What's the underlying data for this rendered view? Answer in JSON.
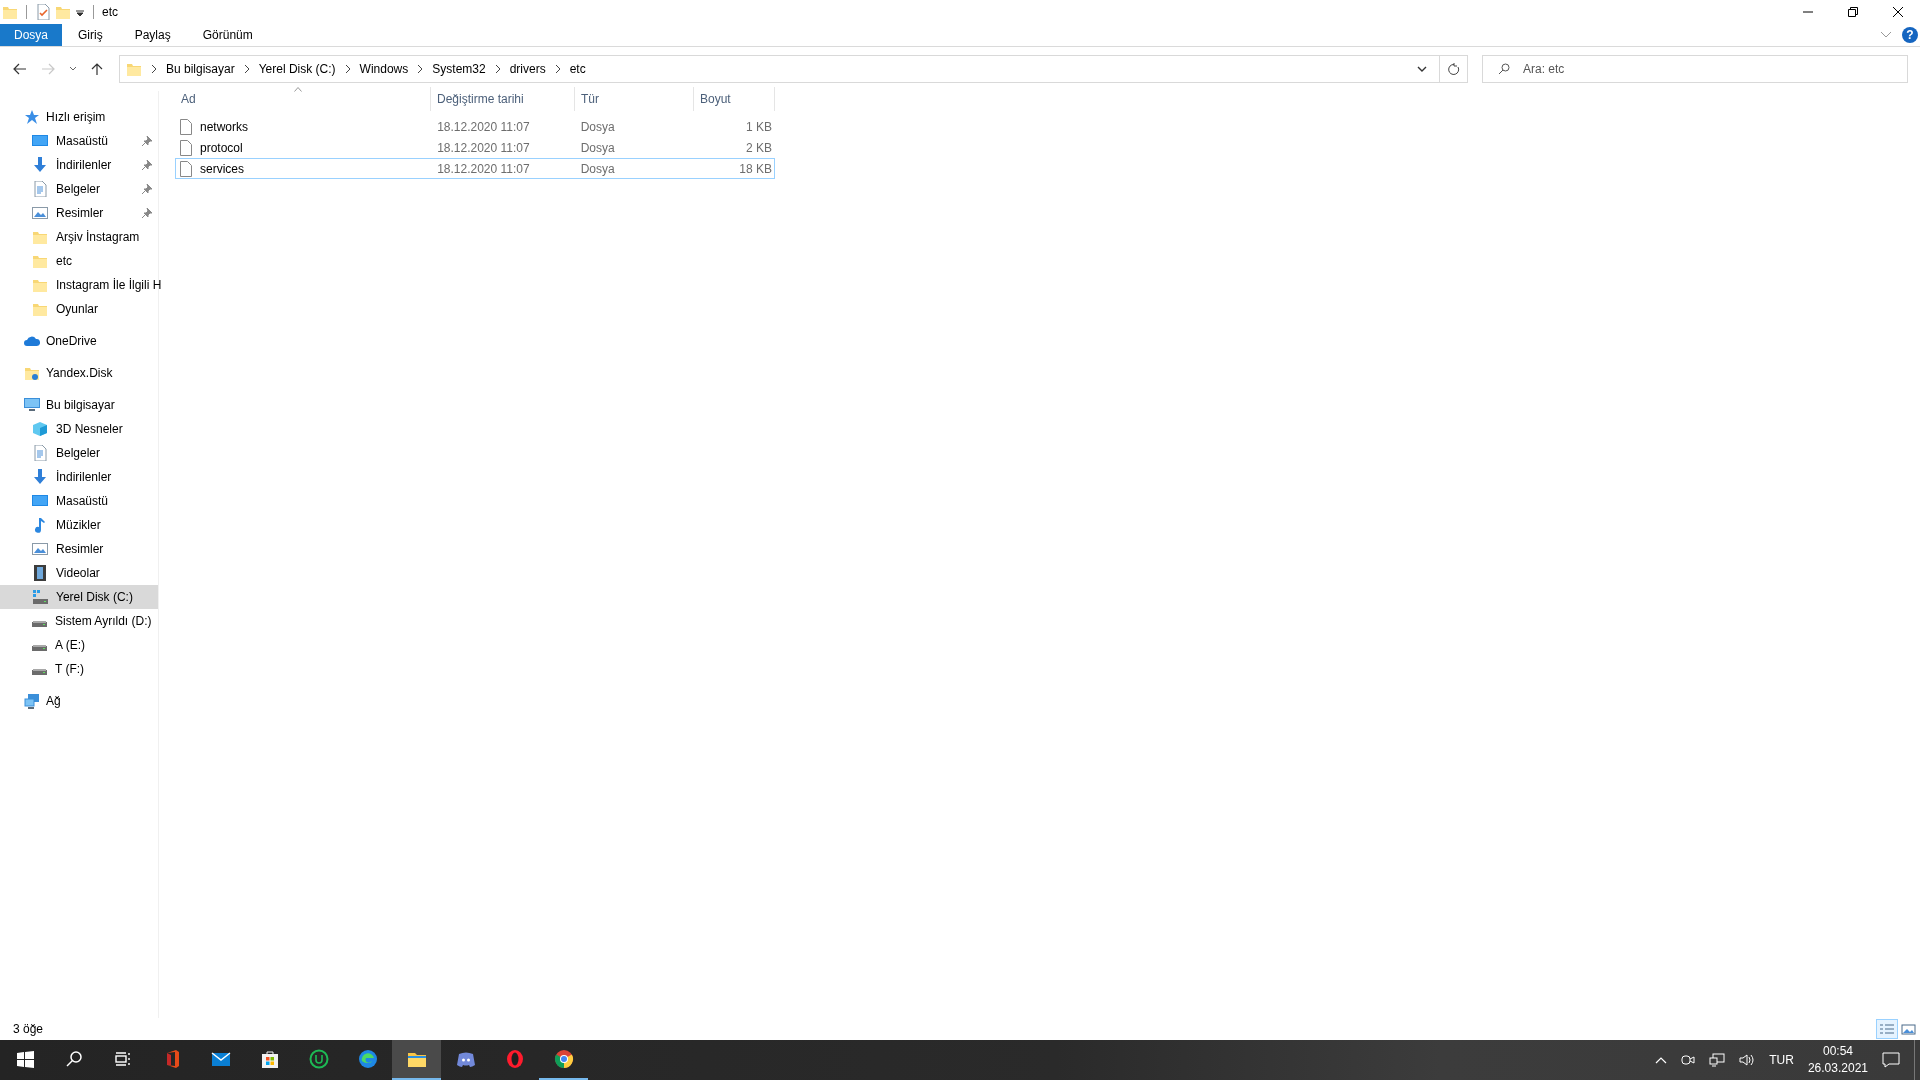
{
  "window": {
    "title": "etc"
  },
  "ribbon": {
    "tabs": [
      {
        "label": "Dosya",
        "kind": "file"
      },
      {
        "label": "Giriş",
        "kind": "tab"
      },
      {
        "label": "Paylaş",
        "kind": "tab"
      },
      {
        "label": "Görünüm",
        "kind": "tab"
      }
    ],
    "help": "?"
  },
  "navigation": {
    "forward_disabled": true,
    "path": [
      "Bu bilgisayar",
      "Yerel Disk (C:)",
      "Windows",
      "System32",
      "drivers",
      "etc"
    ],
    "search": {
      "placeholder": "Ara: etc"
    }
  },
  "sidebar": {
    "sections": [
      {
        "label": "Hızlı erişim",
        "selected": false,
        "children": [
          {
            "label": "Masaüstü",
            "pinned": true,
            "selected": false
          },
          {
            "label": "İndirilenler",
            "pinned": true,
            "selected": false
          },
          {
            "label": "Belgeler",
            "pinned": true,
            "selected": false
          },
          {
            "label": "Resimler",
            "pinned": true,
            "selected": false
          },
          {
            "label": "Arşiv İnstagram",
            "pinned": false,
            "selected": false
          },
          {
            "label": "etc",
            "pinned": false,
            "selected": false
          },
          {
            "label": "Instagram İle İlgili H",
            "pinned": false,
            "selected": false
          },
          {
            "label": "Oyunlar",
            "pinned": false,
            "selected": false
          }
        ]
      },
      {
        "label": "OneDrive",
        "selected": false
      },
      {
        "label": "Yandex.Disk",
        "selected": false
      },
      {
        "label": "Bu bilgisayar",
        "selected": false,
        "children": [
          {
            "label": "3D Nesneler",
            "pinned": false,
            "selected": false
          },
          {
            "label": "Belgeler",
            "pinned": false,
            "selected": false
          },
          {
            "label": "İndirilenler",
            "pinned": false,
            "selected": false
          },
          {
            "label": "Masaüstü",
            "pinned": false,
            "selected": false
          },
          {
            "label": "Müzikler",
            "pinned": false,
            "selected": false
          },
          {
            "label": "Resimler",
            "pinned": false,
            "selected": false
          },
          {
            "label": "Videolar",
            "pinned": false,
            "selected": false
          },
          {
            "label": "Yerel Disk (C:)",
            "pinned": false,
            "selected": true
          },
          {
            "label": "Sistem Ayrıldı (D:)",
            "pinned": false,
            "selected": false
          },
          {
            "label": "A (E:)",
            "pinned": false,
            "selected": false
          },
          {
            "label": "T (F:)",
            "pinned": false,
            "selected": false
          }
        ]
      },
      {
        "label": "Ağ",
        "selected": false
      }
    ]
  },
  "table": {
    "columns": [
      {
        "label": "Ad",
        "sorted": true
      },
      {
        "label": "Değiştirme tarihi",
        "sorted": false
      },
      {
        "label": "Tür",
        "sorted": false
      },
      {
        "label": "Boyut",
        "sorted": false
      }
    ],
    "rows": [
      {
        "name": "networks",
        "date": "18.12.2020 11:07",
        "type": "Dosya",
        "size": "1 KB",
        "selected": false
      },
      {
        "name": "protocol",
        "date": "18.12.2020 11:07",
        "type": "Dosya",
        "size": "2 KB",
        "selected": false
      },
      {
        "name": "services",
        "date": "18.12.2020 11:07",
        "type": "Dosya",
        "size": "18 KB",
        "selected": true
      }
    ]
  },
  "status_bar": {
    "text": "3 öğe",
    "views": [
      {
        "kind": "details",
        "selected": true
      },
      {
        "kind": "large-icons",
        "selected": false
      }
    ]
  },
  "taskbar": {
    "apps": [
      {
        "kind": "start",
        "active": false,
        "running": false
      },
      {
        "kind": "search",
        "active": false,
        "running": false
      },
      {
        "kind": "task-view",
        "active": false,
        "running": false
      },
      {
        "kind": "office",
        "active": false,
        "running": false
      },
      {
        "kind": "mail",
        "active": false,
        "running": false
      },
      {
        "kind": "store",
        "active": false,
        "running": false
      },
      {
        "kind": "u-app",
        "active": false,
        "running": false
      },
      {
        "kind": "edge",
        "active": false,
        "running": false
      },
      {
        "kind": "explorer",
        "active": true,
        "running": true
      },
      {
        "kind": "discord",
        "active": false,
        "running": false
      },
      {
        "kind": "opera",
        "active": false,
        "running": false
      },
      {
        "kind": "chrome",
        "active": false,
        "running": true
      }
    ],
    "language": "TUR",
    "time": "00:54",
    "date": "26.03.2021"
  }
}
